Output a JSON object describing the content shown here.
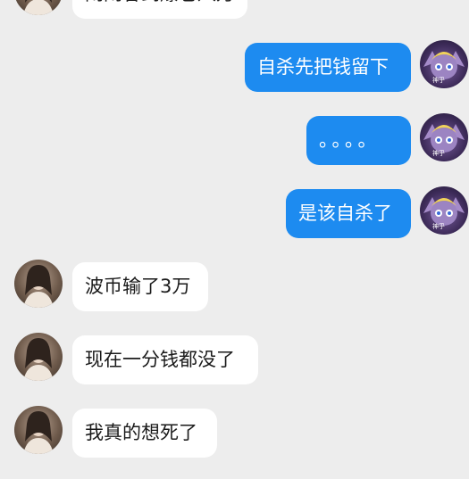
{
  "colors": {
    "background": "#ededed",
    "bubble_incoming": "#ffffff",
    "bubble_outgoing": "#1d8bf0",
    "text_incoming": "#1a1a1a",
    "text_outgoing": "#ffffff"
  },
  "messages": [
    {
      "side": "incoming",
      "text": "闹闹谷到爆仓八万",
      "avatar": "avatar-girl-icon"
    },
    {
      "side": "outgoing",
      "text": "自杀先把钱留下",
      "avatar": "avatar-yordle-icon",
      "avatar_caption": "神乎"
    },
    {
      "side": "outgoing",
      "text": "。。。。",
      "avatar": "avatar-yordle-icon",
      "avatar_caption": "神乎"
    },
    {
      "side": "outgoing",
      "text": "是该自杀了",
      "avatar": "avatar-yordle-icon",
      "avatar_caption": "神乎"
    },
    {
      "side": "incoming",
      "text": "波币输了3万",
      "avatar": "avatar-girl-icon"
    },
    {
      "side": "incoming",
      "text": "现在一分钱都没了",
      "avatar": "avatar-girl-icon"
    },
    {
      "side": "incoming",
      "text": "我真的想死了",
      "avatar": "avatar-girl-icon"
    }
  ]
}
